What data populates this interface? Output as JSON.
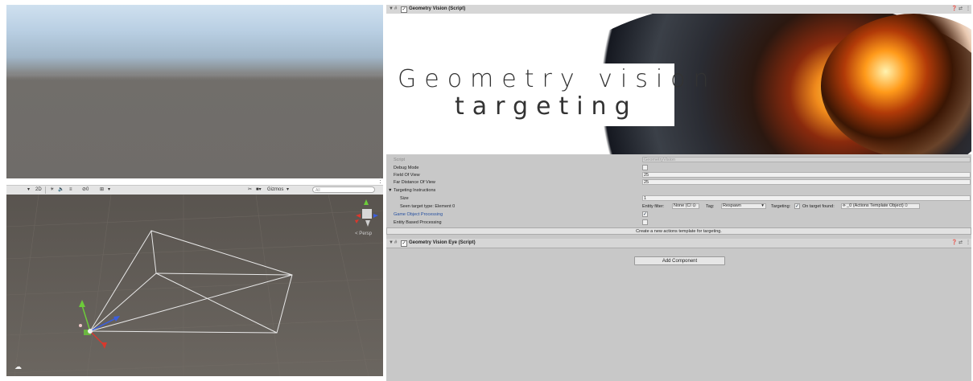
{
  "scene_toolbar": {
    "items": [
      "2D",
      "☀",
      "🔈",
      "≡",
      "⊘0",
      "⊞"
    ],
    "gizmos_label": "Gizmos",
    "search_placeholder": "All"
  },
  "scene_view": {
    "projection_label": "< Persp"
  },
  "inspector": {
    "geometry_vision": {
      "title": "Geometry Vision (Script)",
      "banner_line1": "Geometry vision",
      "banner_line2": "targeting",
      "fields": {
        "script_label": "Script",
        "script_value": "GeometryVision",
        "debug_mode_label": "Debug Mode",
        "field_of_view_label": "Field Of View",
        "field_of_view_value": "25",
        "far_distance_label": "Far Distance Of View",
        "far_distance_value": "25",
        "targeting_instructions_label": "Targeting Instructions",
        "size_label": "Size",
        "size_value": "1",
        "seen_target_label": "Seen target type: Element 0",
        "entity_filter_label": "Entity filter:",
        "entity_filter_value": "None (Cl",
        "tag_label": "Tag:",
        "tag_value": "Respawn",
        "targeting_label": "Targeting:",
        "on_target_found_label": "On target found:",
        "on_target_found_value": "_0 (Actions Template Object)",
        "game_object_processing_label": "Game Object Processing",
        "entity_based_processing_label": "Entity Based Processing",
        "create_template_button": "Create a new actions template for targeting."
      }
    },
    "geometry_vision_eye": {
      "title": "Geometry Vision Eye (Script)"
    },
    "add_component_button": "Add Component"
  }
}
